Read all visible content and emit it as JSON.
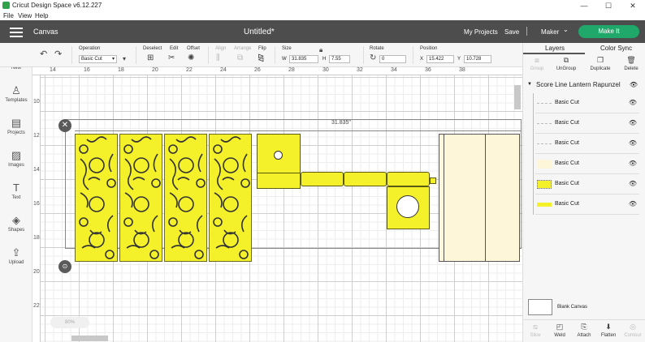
{
  "window": {
    "title": "Cricut Design Space  v6.12.227",
    "controls": [
      "—",
      "☐",
      "✕"
    ]
  },
  "menubar": [
    "File",
    "View",
    "Help"
  ],
  "header": {
    "section": "Canvas",
    "doc_title": "Untitled*",
    "my_projects": "My Projects",
    "save": "Save",
    "machine": "Maker",
    "machine_caret": "⌄",
    "make_it": "Make It"
  },
  "toolbar": {
    "operation_label": "Operation",
    "operation_value": "Basic Cut",
    "deselect_label": "Deselect",
    "edit_label": "Edit",
    "offset_label": "Offset",
    "align_label": "Align",
    "arrange_label": "Arrange",
    "flip_label": "Flip",
    "size_label": "Size",
    "size_w_prefix": "W",
    "size_w": "31.835",
    "size_h_prefix": "H",
    "size_h": "7.55",
    "rotate_label": "Rotate",
    "rotate_value": "0",
    "position_label": "Position",
    "pos_x_prefix": "X",
    "pos_x": "15.422",
    "pos_y_prefix": "Y",
    "pos_y": "10.728"
  },
  "leftpanel": {
    "items": [
      {
        "label": "New",
        "icon": "plus-icon"
      },
      {
        "label": "Templates",
        "icon": "shirt-icon"
      },
      {
        "label": "Projects",
        "icon": "projects-icon"
      },
      {
        "label": "Images",
        "icon": "image-icon"
      },
      {
        "label": "Text",
        "icon": "text-icon"
      },
      {
        "label": "Shapes",
        "icon": "shapes-icon"
      },
      {
        "label": "Upload",
        "icon": "upload-icon"
      }
    ]
  },
  "canvas": {
    "ruler_h": [
      "14",
      "16",
      "18",
      "20",
      "22",
      "24",
      "26",
      "28",
      "30",
      "32",
      "34",
      "36",
      "38"
    ],
    "ruler_v": [
      "10",
      "12",
      "14",
      "16",
      "18",
      "20",
      "22"
    ],
    "dimension_label": "31.835\"",
    "zoom_label": "80%"
  },
  "rightpanel": {
    "tabs": [
      "Layers",
      "Color Sync"
    ],
    "actions": [
      {
        "label": "Group",
        "enabled": false
      },
      {
        "label": "UnGroup",
        "enabled": true
      },
      {
        "label": "Duplicate",
        "enabled": true
      },
      {
        "label": "Delete",
        "enabled": true
      }
    ],
    "group_name": "Score Line Lantern Rapunzel",
    "layers": [
      {
        "name": "Basic Cut",
        "thumb": "dash"
      },
      {
        "name": "Basic Cut",
        "thumb": "dash"
      },
      {
        "name": "Basic Cut",
        "thumb": "dash"
      },
      {
        "name": "Basic Cut",
        "thumb": "cream"
      },
      {
        "name": "Basic Cut",
        "thumb": "panel"
      },
      {
        "name": "Basic Cut",
        "thumb": "strip"
      }
    ],
    "blank_canvas": "Blank Canvas",
    "bottom_actions": [
      {
        "label": "Slice",
        "enabled": false
      },
      {
        "label": "Weld",
        "enabled": true
      },
      {
        "label": "Attach",
        "enabled": true
      },
      {
        "label": "Flatten",
        "enabled": true
      },
      {
        "label": "Contour",
        "enabled": false
      }
    ]
  },
  "colors": {
    "header_bg": "#4d4d4d",
    "make_it": "#1fa86a",
    "panel_yellow": "#f4f02a",
    "cream": "#fdf6d8"
  }
}
